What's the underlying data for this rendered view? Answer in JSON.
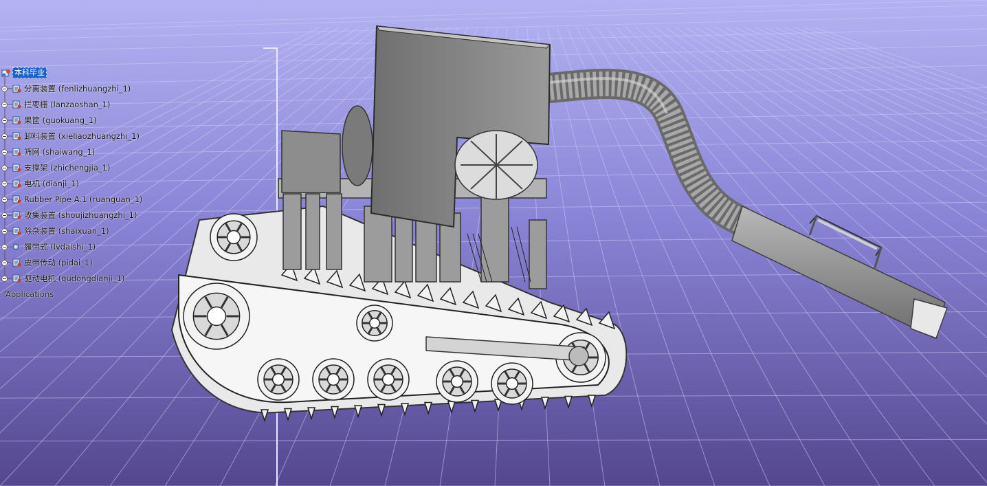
{
  "spec_tree": {
    "root": {
      "label": "本科毕业",
      "icon": "product-icon"
    },
    "items": [
      {
        "label": "分离装置 (fenlizhuangzhi_1)",
        "icon": "part-icon"
      },
      {
        "label": "拦枣栅 (lanzaoshan_1)",
        "icon": "part-icon"
      },
      {
        "label": "果筐 (guokuang_1)",
        "icon": "part-icon"
      },
      {
        "label": "卸料装置 (xieliaozhuangzhi_1)",
        "icon": "part-icon"
      },
      {
        "label": "筛网 (shaiwang_1)",
        "icon": "part-icon"
      },
      {
        "label": "支撑架 (zhichengjia_1)",
        "icon": "part-icon"
      },
      {
        "label": "电机 (dianji_1)",
        "icon": "part-icon"
      },
      {
        "label": "Rubber Pipe A.1 (ruanguan_1)",
        "icon": "part-icon"
      },
      {
        "label": "收集装置 (shoujizhuangzhi_1)",
        "icon": "part-icon"
      },
      {
        "label": "除杂装置 (shaixuan_1)",
        "icon": "part-icon"
      },
      {
        "label": "履带式 (lvdaishi_1)",
        "icon": "gear-part-icon"
      },
      {
        "label": "皮带传动 (pidai_1)",
        "icon": "part-icon"
      },
      {
        "label": "驱动电机 (qudongdianji_1)",
        "icon": "part-icon"
      }
    ],
    "applications": {
      "label": "Applications"
    }
  },
  "colors": {
    "sky_top": "#a9a9ef",
    "sky_bottom": "#5d4f9a",
    "grid_line": "#cfc8f4",
    "selection": "#1f5fc9",
    "model_gray": "#8e8e8e"
  }
}
